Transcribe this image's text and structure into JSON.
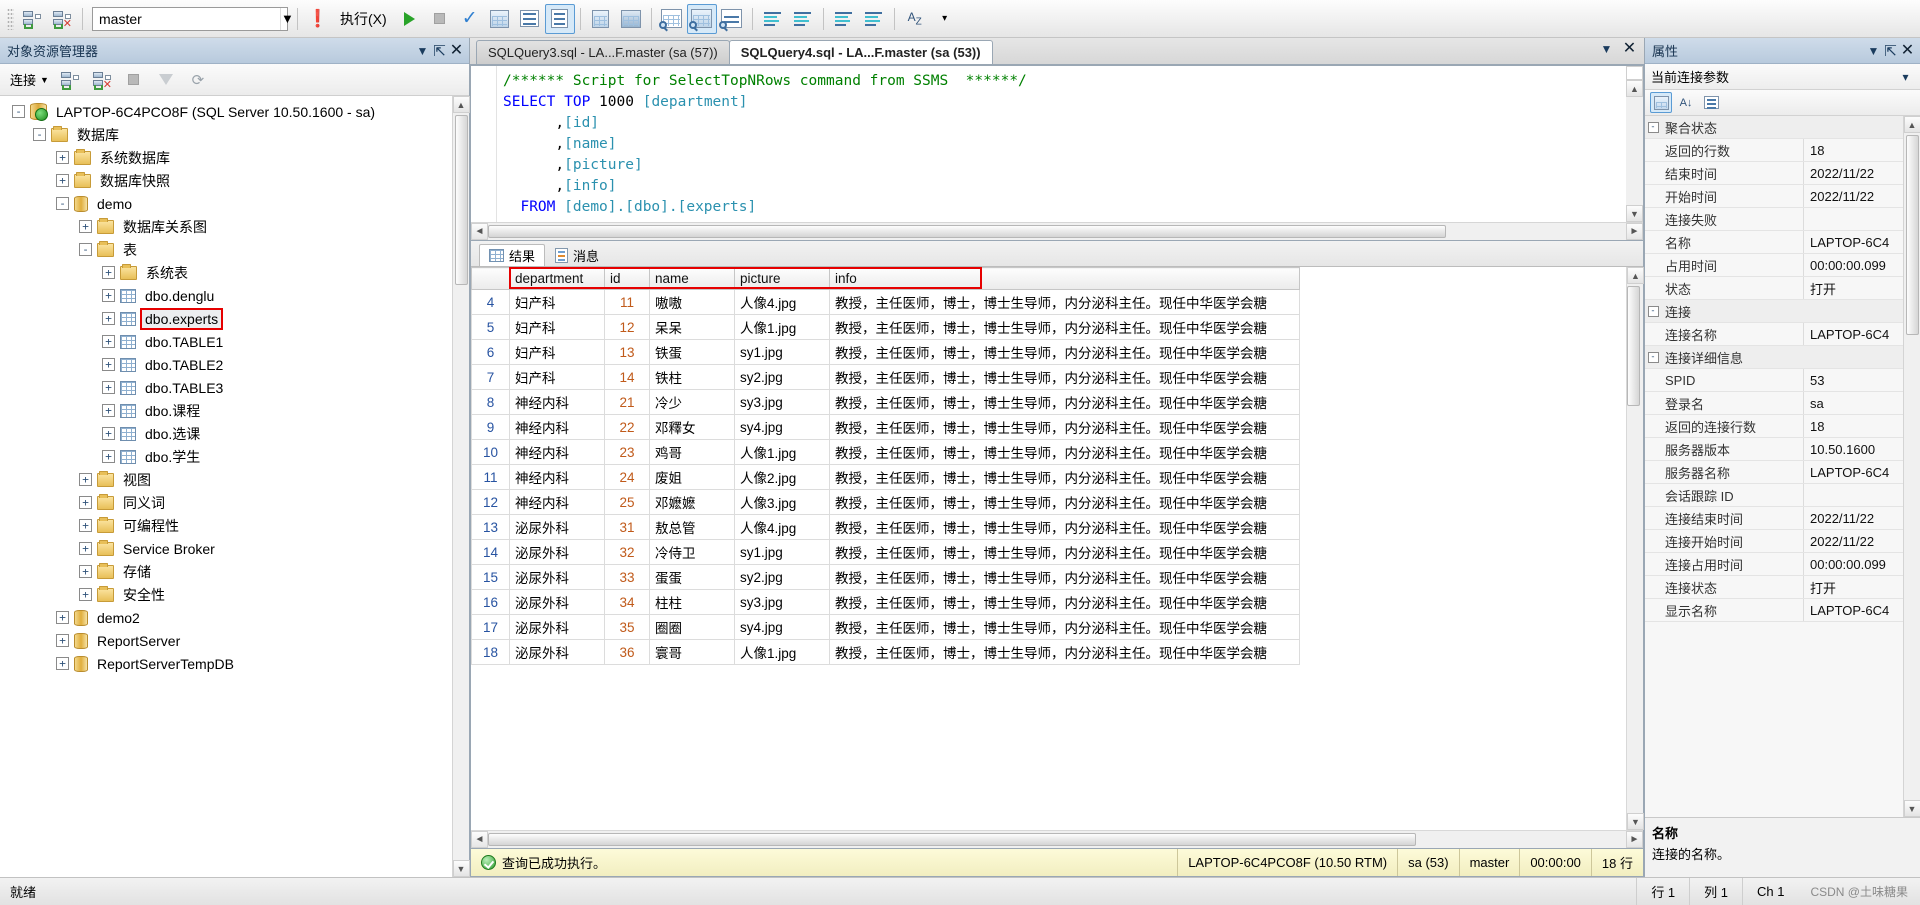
{
  "toolbar": {
    "database_value": "master",
    "execute_label": "执行(X)",
    "icons": [
      "new-query-icon",
      "disconnect-icon",
      "bang-icon",
      "play-icon",
      "stop-icon",
      "parse-check-icon",
      "display-estimated-plan-icon",
      "query-options-icon",
      "results-to-text-icon",
      "include-actual-plan-icon",
      "activity-monitor-icon",
      "results-to-grid-icon",
      "results-to-file-icon",
      "results-to-another-icon",
      "comment-icon",
      "uncomment-icon",
      "indent-icon",
      "outdent-icon",
      "specify-values-icon"
    ]
  },
  "object_explorer": {
    "title": "对象资源管理器",
    "connect_label": "连接",
    "tree": [
      {
        "indent": 0,
        "expander": "-",
        "icon": "server",
        "label": "LAPTOP-6C4PCO8F (SQL Server 10.50.1600 - sa)"
      },
      {
        "indent": 1,
        "expander": "-",
        "icon": "folder",
        "label": "数据库"
      },
      {
        "indent": 2,
        "expander": "+",
        "icon": "folder",
        "label": "系统数据库"
      },
      {
        "indent": 2,
        "expander": "+",
        "icon": "folder",
        "label": "数据库快照"
      },
      {
        "indent": 2,
        "expander": "-",
        "icon": "cylinder",
        "label": "demo"
      },
      {
        "indent": 3,
        "expander": "+",
        "icon": "folder",
        "label": "数据库关系图"
      },
      {
        "indent": 3,
        "expander": "-",
        "icon": "folder",
        "label": "表"
      },
      {
        "indent": 4,
        "expander": "+",
        "icon": "folder",
        "label": "系统表"
      },
      {
        "indent": 4,
        "expander": "+",
        "icon": "table",
        "label": "dbo.denglu"
      },
      {
        "indent": 4,
        "expander": "+",
        "icon": "table",
        "label": "dbo.experts",
        "highlight": true
      },
      {
        "indent": 4,
        "expander": "+",
        "icon": "table",
        "label": "dbo.TABLE1"
      },
      {
        "indent": 4,
        "expander": "+",
        "icon": "table",
        "label": "dbo.TABLE2"
      },
      {
        "indent": 4,
        "expander": "+",
        "icon": "table",
        "label": "dbo.TABLE3"
      },
      {
        "indent": 4,
        "expander": "+",
        "icon": "table",
        "label": "dbo.课程"
      },
      {
        "indent": 4,
        "expander": "+",
        "icon": "table",
        "label": "dbo.选课"
      },
      {
        "indent": 4,
        "expander": "+",
        "icon": "table",
        "label": "dbo.学生"
      },
      {
        "indent": 3,
        "expander": "+",
        "icon": "folder",
        "label": "视图"
      },
      {
        "indent": 3,
        "expander": "+",
        "icon": "folder",
        "label": "同义词"
      },
      {
        "indent": 3,
        "expander": "+",
        "icon": "folder",
        "label": "可编程性"
      },
      {
        "indent": 3,
        "expander": "+",
        "icon": "folder",
        "label": "Service Broker"
      },
      {
        "indent": 3,
        "expander": "+",
        "icon": "folder",
        "label": "存储"
      },
      {
        "indent": 3,
        "expander": "+",
        "icon": "folder",
        "label": "安全性"
      },
      {
        "indent": 2,
        "expander": "+",
        "icon": "cylinder",
        "label": "demo2"
      },
      {
        "indent": 2,
        "expander": "+",
        "icon": "cylinder",
        "label": "ReportServer"
      },
      {
        "indent": 2,
        "expander": "+",
        "icon": "cylinder",
        "label": "ReportServerTempDB"
      }
    ]
  },
  "editor": {
    "tabs": [
      {
        "label": "SQLQuery4.sql - LA...F.master (sa (53))",
        "active": true
      },
      {
        "label": "SQLQuery3.sql - LA...F.master (sa (57))",
        "active": false
      }
    ],
    "code_lines": [
      {
        "parts": [
          {
            "t": "/****** Script for SelectTopNRows command from SSMS  ******/",
            "c": "cm"
          }
        ]
      },
      {
        "parts": [
          {
            "t": "SELECT",
            "c": "k"
          },
          {
            "t": " ",
            "c": ""
          },
          {
            "t": "TOP",
            "c": "k"
          },
          {
            "t": " 1000 ",
            "c": ""
          },
          {
            "t": "[department]",
            "c": "id"
          }
        ]
      },
      {
        "parts": [
          {
            "t": "      ,",
            "c": ""
          },
          {
            "t": "[id]",
            "c": "id"
          }
        ]
      },
      {
        "parts": [
          {
            "t": "      ,",
            "c": ""
          },
          {
            "t": "[name]",
            "c": "id"
          }
        ]
      },
      {
        "parts": [
          {
            "t": "      ,",
            "c": ""
          },
          {
            "t": "[picture]",
            "c": "id"
          }
        ]
      },
      {
        "parts": [
          {
            "t": "      ,",
            "c": ""
          },
          {
            "t": "[info]",
            "c": "id"
          }
        ]
      },
      {
        "parts": [
          {
            "t": "  FROM",
            "c": "k"
          },
          {
            "t": " ",
            "c": ""
          },
          {
            "t": "[demo].[dbo].[experts]",
            "c": "id"
          }
        ]
      }
    ]
  },
  "results": {
    "tabs": [
      {
        "label": "结果",
        "icon": "grid-icon",
        "active": true
      },
      {
        "label": "消息",
        "icon": "message-icon",
        "active": false
      }
    ],
    "columns": [
      "department",
      "id",
      "name",
      "picture",
      "info"
    ],
    "rows": [
      {
        "n": "4",
        "department": "妇产科",
        "id": "11",
        "name": "嗷嗷",
        "picture": "人像4.jpg",
        "info": "教授，主任医师，博士，博士生导师，内分泌科主任。现任中华医学会糖"
      },
      {
        "n": "5",
        "department": "妇产科",
        "id": "12",
        "name": "呆呆",
        "picture": "人像1.jpg",
        "info": "教授，主任医师，博士，博士生导师，内分泌科主任。现任中华医学会糖"
      },
      {
        "n": "6",
        "department": "妇产科",
        "id": "13",
        "name": "铁蛋",
        "picture": "sy1.jpg",
        "info": "教授，主任医师，博士，博士生导师，内分泌科主任。现任中华医学会糖"
      },
      {
        "n": "7",
        "department": "妇产科",
        "id": "14",
        "name": "铁柱",
        "picture": "sy2.jpg",
        "info": "教授，主任医师，博士，博士生导师，内分泌科主任。现任中华医学会糖"
      },
      {
        "n": "8",
        "department": "神经内科",
        "id": "21",
        "name": "冷少",
        "picture": "sy3.jpg",
        "info": "教授，主任医师，博士，博士生导师，内分泌科主任。现任中华医学会糖"
      },
      {
        "n": "9",
        "department": "神经内科",
        "id": "22",
        "name": "邓釋女",
        "picture": "sy4.jpg",
        "info": "教授，主任医师，博士，博士生导师，内分泌科主任。现任中华医学会糖"
      },
      {
        "n": "10",
        "department": "神经内科",
        "id": "23",
        "name": "鸡哥",
        "picture": "人像1.jpg",
        "info": "教授，主任医师，博士，博士生导师，内分泌科主任。现任中华医学会糖"
      },
      {
        "n": "11",
        "department": "神经内科",
        "id": "24",
        "name": "废姐",
        "picture": "人像2.jpg",
        "info": "教授，主任医师，博士，博士生导师，内分泌科主任。现任中华医学会糖"
      },
      {
        "n": "12",
        "department": "神经内科",
        "id": "25",
        "name": "邓嬷嬷",
        "picture": "人像3.jpg",
        "info": "教授，主任医师，博士，博士生导师，内分泌科主任。现任中华医学会糖"
      },
      {
        "n": "13",
        "department": "泌尿外科",
        "id": "31",
        "name": "敖总管",
        "picture": "人像4.jpg",
        "info": "教授，主任医师，博士，博士生导师，内分泌科主任。现任中华医学会糖"
      },
      {
        "n": "14",
        "department": "泌尿外科",
        "id": "32",
        "name": "冷侍卫",
        "picture": "sy1.jpg",
        "info": "教授，主任医师，博士，博士生导师，内分泌科主任。现任中华医学会糖"
      },
      {
        "n": "15",
        "department": "泌尿外科",
        "id": "33",
        "name": "蛋蛋",
        "picture": "sy2.jpg",
        "info": "教授，主任医师，博士，博士生导师，内分泌科主任。现任中华医学会糖"
      },
      {
        "n": "16",
        "department": "泌尿外科",
        "id": "34",
        "name": "柱柱",
        "picture": "sy3.jpg",
        "info": "教授，主任医师，博士，博士生导师，内分泌科主任。现任中华医学会糖"
      },
      {
        "n": "17",
        "department": "泌尿外科",
        "id": "35",
        "name": "圈圈",
        "picture": "sy4.jpg",
        "info": "教授，主任医师，博士，博士生导师，内分泌科主任。现任中华医学会糖"
      },
      {
        "n": "18",
        "department": "泌尿外科",
        "id": "36",
        "name": "寰哥",
        "picture": "人像1.jpg",
        "info": "教授，主任医师，博士，博士生导师，内分泌科主任。现任中华医学会糖"
      }
    ],
    "status": {
      "message": "查询已成功执行。",
      "server": "LAPTOP-6C4PCO8F (10.50 RTM)",
      "user": "sa (53)",
      "database": "master",
      "elapsed": "00:00:00",
      "rowcount": "18 行"
    }
  },
  "properties": {
    "title": "属性",
    "subtitle": "当前连接参数",
    "rows": [
      {
        "type": "cat",
        "expander": "-",
        "name": "聚合状态",
        "value": ""
      },
      {
        "type": "prop",
        "name": "返回的行数",
        "value": "18"
      },
      {
        "type": "prop",
        "name": "结束时间",
        "value": "2022/11/22"
      },
      {
        "type": "prop",
        "name": "开始时间",
        "value": "2022/11/22"
      },
      {
        "type": "prop",
        "name": "连接失败",
        "value": ""
      },
      {
        "type": "prop",
        "name": "名称",
        "value": "LAPTOP-6C4"
      },
      {
        "type": "prop",
        "name": "占用时间",
        "value": "00:00:00.099"
      },
      {
        "type": "prop",
        "name": "状态",
        "value": "打开"
      },
      {
        "type": "cat",
        "expander": "-",
        "name": "连接",
        "value": ""
      },
      {
        "type": "prop",
        "name": "连接名称",
        "value": "LAPTOP-6C4"
      },
      {
        "type": "cat",
        "expander": "-",
        "name": "连接详细信息",
        "value": ""
      },
      {
        "type": "prop",
        "name": "SPID",
        "value": "53"
      },
      {
        "type": "prop",
        "name": "登录名",
        "value": "sa"
      },
      {
        "type": "prop",
        "name": "返回的连接行数",
        "value": "18"
      },
      {
        "type": "prop",
        "name": "服务器版本",
        "value": "10.50.1600"
      },
      {
        "type": "prop",
        "name": "服务器名称",
        "value": "LAPTOP-6C4"
      },
      {
        "type": "prop",
        "name": "会话跟踪 ID",
        "value": ""
      },
      {
        "type": "prop",
        "name": "连接结束时间",
        "value": "2022/11/22"
      },
      {
        "type": "prop",
        "name": "连接开始时间",
        "value": "2022/11/22"
      },
      {
        "type": "prop",
        "name": "连接占用时间",
        "value": "00:00:00.099"
      },
      {
        "type": "prop",
        "name": "连接状态",
        "value": "打开"
      },
      {
        "type": "prop",
        "name": "显示名称",
        "value": "LAPTOP-6C4"
      }
    ],
    "desc_title": "名称",
    "desc_body": "连接的名称。"
  },
  "app_status": {
    "ready": "就绪",
    "line": "行 1",
    "col": "列 1",
    "ch": "Ch 1",
    "watermark": "CSDN @土味糖果"
  }
}
